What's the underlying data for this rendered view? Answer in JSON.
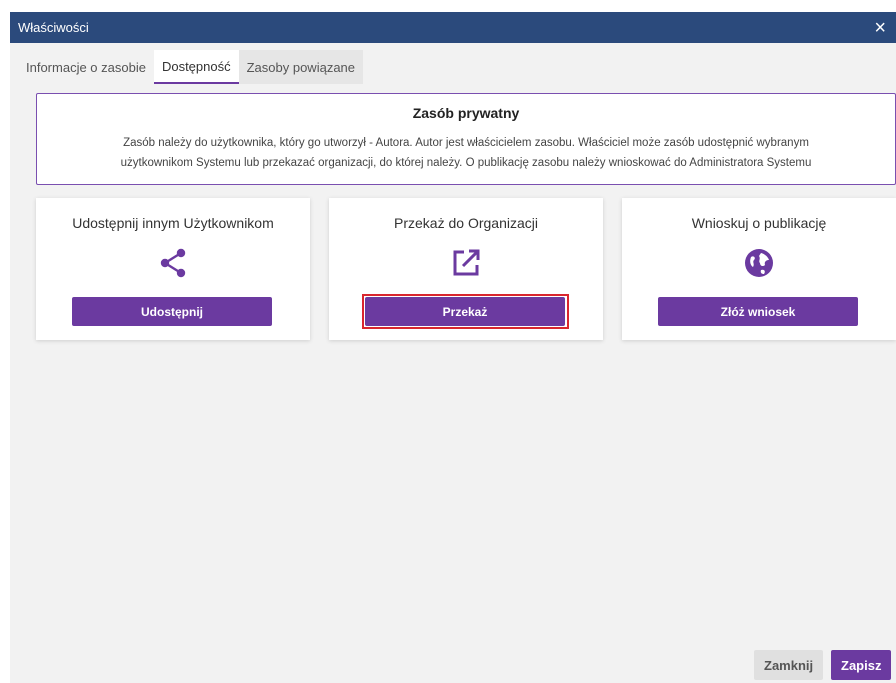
{
  "dialog": {
    "title": "Właściwości",
    "close_glyph": "×"
  },
  "tabs": [
    {
      "label": "Informacje o zasobie"
    },
    {
      "label": "Dostępność"
    },
    {
      "label": "Zasoby powiązane"
    }
  ],
  "info": {
    "heading": "Zasób prywatny",
    "line1": "Zasób należy do użytkownika, który go utworzył - Autora. Autor jest właścicielem zasobu. Właściciel może zasób udostępnić wybranym",
    "line2": "użytkownikom Systemu lub przekazać organizacji, do której należy. O publikację zasobu należy wnioskować do Administratora Systemu"
  },
  "cards": [
    {
      "title": "Udostępnij innym Użytkownikom",
      "icon": "share-icon",
      "button": "Udostępnij"
    },
    {
      "title": "Przekaż do Organizacji",
      "icon": "external-link-icon",
      "button": "Przekaż"
    },
    {
      "title": "Wnioskuj o publikację",
      "icon": "globe-icon",
      "button": "Złóż wniosek"
    }
  ],
  "footer": {
    "close_label": "Zamknij",
    "save_label": "Zapisz"
  },
  "colors": {
    "accent": "#6b3aa0",
    "titlebar": "#2b4a7c",
    "highlight": "#d9262e"
  }
}
